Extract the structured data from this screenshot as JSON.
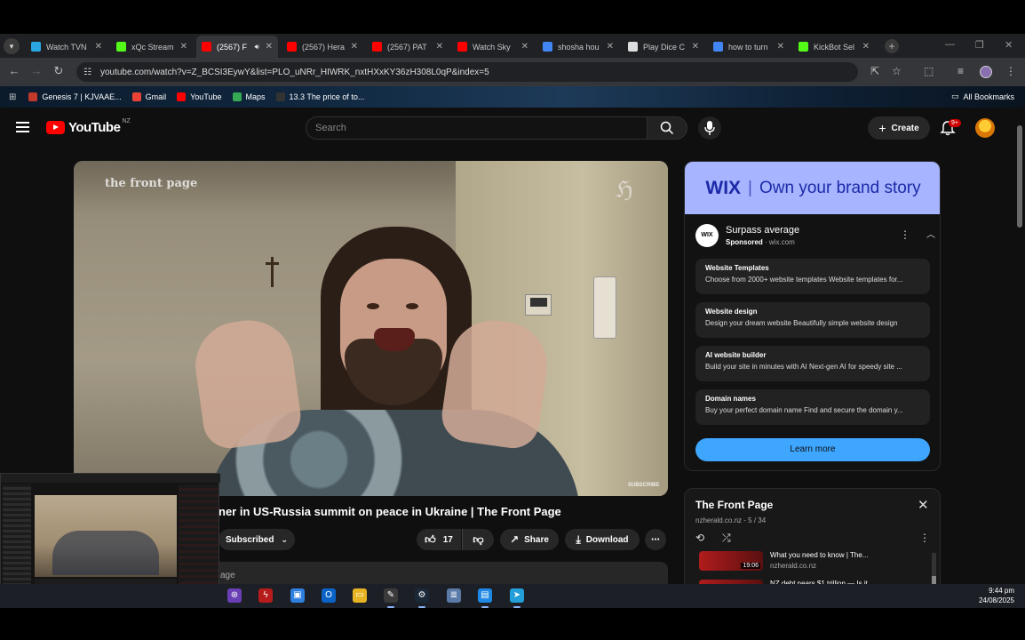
{
  "browser": {
    "tabs": [
      {
        "label": "Watch TVN",
        "favicon_color": "#2aa7e0",
        "active": false
      },
      {
        "label": "xQc Stream",
        "favicon_color": "#53fc18",
        "active": false
      },
      {
        "label": "(2567) F",
        "favicon_color": "#ff0000",
        "active": true,
        "audio": true
      },
      {
        "label": "(2567) Hera",
        "favicon_color": "#ff0000",
        "active": false
      },
      {
        "label": "(2567) PAT",
        "favicon_color": "#ff0000",
        "active": false
      },
      {
        "label": "Watch Sky",
        "favicon_color": "#ff0000",
        "active": false
      },
      {
        "label": "shosha hou",
        "favicon_color": "#4285f4",
        "active": false
      },
      {
        "label": "Play Dice C",
        "favicon_color": "#dddddd",
        "active": false
      },
      {
        "label": "how to turn",
        "favicon_color": "#4285f4",
        "active": false
      },
      {
        "label": "KickBot Sel",
        "favicon_color": "#53fc18",
        "active": false
      }
    ],
    "url": "youtube.com/watch?v=Z_BCSI3EywY&list=PLO_uNRr_HIWRK_nxtHXxKY36zH308L0qP&index=5",
    "bookmarks": [
      {
        "label": "Genesis 7 | KJVAAE...",
        "color": "#c0392b"
      },
      {
        "label": "Gmail",
        "color": "#ea4335"
      },
      {
        "label": "YouTube",
        "color": "#ff0000"
      },
      {
        "label": "Maps",
        "color": "#34a853"
      },
      {
        "label": "13.3 The price of to...",
        "color": "#333333"
      }
    ],
    "all_bookmarks_label": "All Bookmarks"
  },
  "youtube": {
    "region": "NZ",
    "logo_text": "YouTube",
    "search_placeholder": "Search",
    "create_label": "Create",
    "notification_count": "9+",
    "video": {
      "title": "ner in US-Russia summit on peace in Ukraine | The Front Page",
      "watermark_left": "the front page",
      "watermark_subscribe": "SUBSCRIBE",
      "subscribed_label": "Subscribed",
      "like_count": "17",
      "share_label": "Share",
      "download_label": "Download",
      "description_snippet": "age"
    },
    "ad": {
      "banner_brand": "WIX",
      "banner_tagline": "Own your brand story",
      "logo_text": "WIX",
      "title": "Surpass average",
      "sponsored": "Sponsored",
      "domain": "wix.com",
      "links": [
        {
          "heading": "Website Templates",
          "desc": "Choose from 2000+ website templates Website templates for..."
        },
        {
          "heading": "Website design",
          "desc": "Design your dream website Beautifully simple website design"
        },
        {
          "heading": "AI website builder",
          "desc": "Build your site in minutes with AI Next-gen AI for speedy site ..."
        },
        {
          "heading": "Domain names",
          "desc": "Buy your perfect domain name Find and secure the domain y..."
        }
      ],
      "cta": "Learn more",
      "accent_color": "#3ea6ff",
      "banner_color": "#a7b4ff"
    },
    "playlist": {
      "title": "The Front Page",
      "channel": "nzherald.co.nz",
      "position": "5 / 34",
      "items": [
        {
          "title": "What you need to know | The...",
          "duration": "19:06",
          "channel": "nzherald.co.nz"
        },
        {
          "title": "NZ debt nears $1 trillion — Is it...",
          "duration": "",
          "channel": ""
        }
      ]
    }
  },
  "taskbar": {
    "time": "9:44 pm",
    "date": "24/08/2025",
    "apps": [
      "obs-icon",
      "flash-icon",
      "store-icon",
      "outlook-icon",
      "file-explorer-icon",
      "feather-icon",
      "steam-icon",
      "notepad-icon",
      "app-icon",
      "telegram-icon"
    ]
  }
}
